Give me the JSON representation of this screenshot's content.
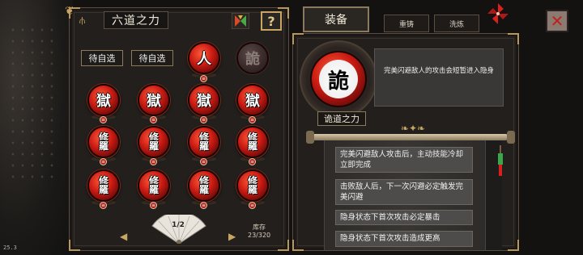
{
  "debug": {
    "fps": "25.3"
  },
  "left_panel": {
    "title": "六道之力",
    "help_label": "?",
    "slots": [
      {
        "kind": "button",
        "label": "待自选"
      },
      {
        "kind": "button",
        "label": "待自选"
      },
      {
        "kind": "orb",
        "glyph": "人",
        "dim": false
      },
      {
        "kind": "orb",
        "glyph": "詭",
        "dim": true
      }
    ],
    "grid": [
      [
        "獄",
        "獄",
        "獄",
        "獄"
      ],
      [
        "修羅",
        "修羅",
        "修羅",
        "修羅"
      ],
      [
        "修羅",
        "修羅",
        "修羅",
        "修羅"
      ]
    ],
    "page_indicator": "1/2",
    "stock_label": "库存",
    "stock_value": "23/320"
  },
  "right_panel": {
    "tabs": [
      {
        "label": "装备",
        "active": true
      },
      {
        "label": "重铸",
        "active": false
      },
      {
        "label": "洗炼",
        "active": false
      }
    ],
    "close_label": "✕",
    "item": {
      "glyph": "詭",
      "name": "诡道之力",
      "description": "完美闪避敌人的攻击会短暂进入隐身"
    },
    "effects": [
      "完美闪避敌人攻击后，主动技能冷却立即完成",
      "击败敌人后，下一次闪避必定触发完美闪避",
      "隐身状态下首次攻击必定暴击",
      "隐身状态下首次攻击造成更高"
    ]
  },
  "colors": {
    "accent_gold": "#c9a562",
    "orb_red": "#c91a12",
    "panel_bg": "#221f1d"
  }
}
